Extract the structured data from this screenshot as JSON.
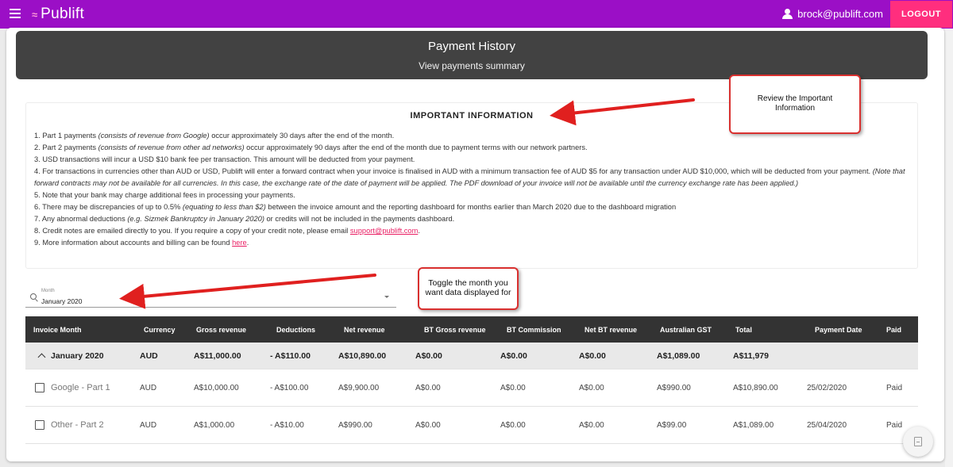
{
  "app": {
    "logo_text": "Publift",
    "user_email": "brock@publift.com",
    "logout_label": "LOGOUT"
  },
  "header": {
    "title": "Payment History",
    "subtitle_link": "View payments summary"
  },
  "important_info": {
    "title": "IMPORTANT INFORMATION",
    "items": {
      "i1_a": "1. Part 1 payments ",
      "i1_em": "(consists of revenue from Google)",
      "i1_b": " occur approximately 30 days after the end of the month.",
      "i2_a": "2. Part 2 payments ",
      "i2_em": "(consists of revenue from other ad networks)",
      "i2_b": " occur approximately 90 days after the end of the month due to payment terms with our network partners.",
      "i3": "3. USD transactions will incur a USD $10 bank fee per transaction. This amount will be deducted from your payment.",
      "i4_a": "4. For transactions in currencies other than AUD or USD, Publift will enter a forward contract when your invoice is finalised in AUD with a minimum transaction fee of AUD $5 for any transaction under AUD $10,000, which will be deducted from your payment. ",
      "i4_em": "(Note that forward contracts may not be available for all currencies. In this case, the exchange rate of the date of payment will be applied. The PDF download of your invoice will not be available until the currency exchange rate has been applied.)",
      "i5": "5. Note that your bank may charge additional fees in processing your payments.",
      "i6_a": "6. There may be discrepancies of up to 0.5% ",
      "i6_em": "(equating to less than $2)",
      "i6_b": " between the invoice amount and the reporting dashboard for months earlier than March 2020 due to the dashboard migration",
      "i7_a": "7. Any abnormal deductions ",
      "i7_em": "(e.g. Sizmek Bankruptcy in January 2020)",
      "i7_b": " or credits will not be included in the payments dashboard.",
      "i8_a": "8. Credit notes are emailed directly to you. If you require a copy of your credit note, please email ",
      "i8_link": "support@publift.com",
      "i8_b": ".",
      "i9_a": "9. More information about accounts and billing can be found ",
      "i9_link": "here",
      "i9_b": "."
    }
  },
  "month_select": {
    "label": "Month",
    "value": "January 2020"
  },
  "table": {
    "headers": {
      "invoice_month": "Invoice Month",
      "currency": "Currency",
      "gross": "Gross revenue",
      "deductions": "Deductions",
      "net": "Net revenue",
      "bt_gross": "BT Gross revenue",
      "bt_commission": "BT Commission",
      "net_bt": "Net BT revenue",
      "gst": "Australian GST",
      "total": "Total",
      "payment_date": "Payment Date",
      "paid": "Paid"
    },
    "group": {
      "name": "January 2020",
      "currency": "AUD",
      "gross": "A$11,000.00",
      "deductions": "- A$110.00",
      "net": "A$10,890.00",
      "bt_gross": "A$0.00",
      "bt_commission": "A$0.00",
      "net_bt": "A$0.00",
      "gst": "A$1,089.00",
      "total": "A$11,979",
      "payment_date": "",
      "paid": ""
    },
    "rows": [
      {
        "name": "Google - Part 1",
        "currency": "AUD",
        "gross": "A$10,000.00",
        "deductions": "- A$100.00",
        "net": "A$9,900.00",
        "bt_gross": "A$0.00",
        "bt_commission": "A$0.00",
        "net_bt": "A$0.00",
        "gst": "A$990.00",
        "total": "A$10,890.00",
        "payment_date": "25/02/2020",
        "paid": "Paid"
      },
      {
        "name": "Other - Part 2",
        "currency": "AUD",
        "gross": "A$1,000.00",
        "deductions": "- A$10.00",
        "net": "A$990.00",
        "bt_gross": "A$0.00",
        "bt_commission": "A$0.00",
        "net_bt": "A$0.00",
        "gst": "A$99.00",
        "total": "A$1,089.00",
        "payment_date": "25/04/2020",
        "paid": "Paid"
      }
    ]
  },
  "callouts": {
    "review_line1": "Review the Important",
    "review_line2": "Information",
    "toggle_line1": "Toggle the month you",
    "toggle_line2": "want data displayed for"
  },
  "colors": {
    "topbar": "#9b0fc6",
    "logout": "#ff2e7e",
    "header_bg": "#424242",
    "callout_border": "#d9302f"
  }
}
